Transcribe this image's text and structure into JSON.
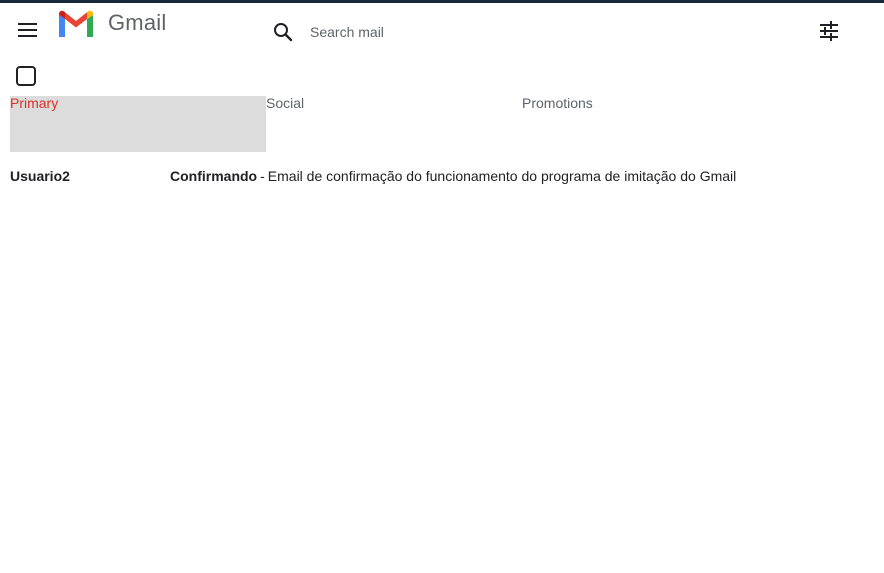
{
  "header": {
    "brand": "Gmail",
    "search_placeholder": "Search mail"
  },
  "icons": {
    "menu": "menu-icon",
    "logo": "gmail-logo",
    "search": "search-icon",
    "tune": "tune-icon"
  },
  "colors": {
    "active_tab_text": "#d93025",
    "active_tab_bg": "#dcdcdc",
    "top_bar": "#17263a"
  },
  "tabs": [
    {
      "label": "Primary",
      "active": true
    },
    {
      "label": "Social",
      "active": false
    },
    {
      "label": "Promotions",
      "active": false
    }
  ],
  "emails": [
    {
      "sender": "Usuario2",
      "subject": "Confirmando",
      "separator": "-",
      "snippet": "Email de confirmação do funcionamento do programa de imitação do Gmail"
    }
  ]
}
